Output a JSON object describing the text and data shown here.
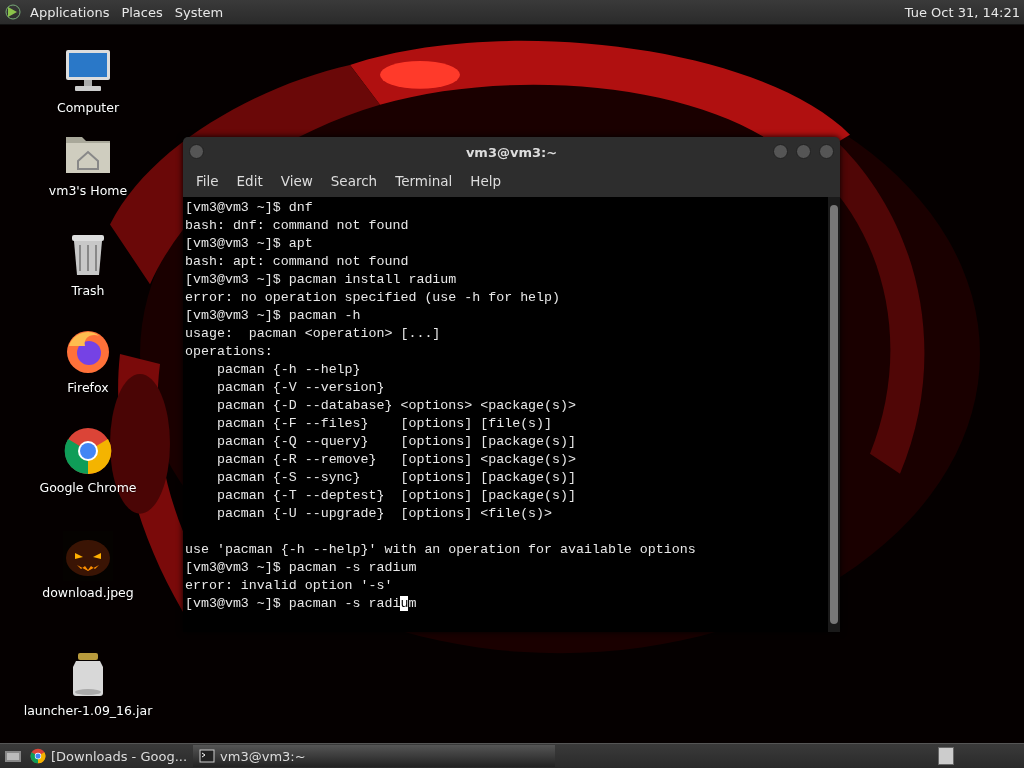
{
  "top_panel": {
    "menus": [
      "Applications",
      "Places",
      "System"
    ],
    "clock": "Tue Oct 31, 14:21"
  },
  "desktop_icons": [
    {
      "kind": "computer",
      "label": "Computer"
    },
    {
      "kind": "home",
      "label": "vm3's Home"
    },
    {
      "kind": "trash",
      "label": "Trash"
    },
    {
      "kind": "firefox",
      "label": "Firefox"
    },
    {
      "kind": "chrome",
      "label": "Google Chrome"
    },
    {
      "kind": "picture",
      "label": "download.jpeg"
    },
    {
      "kind": "jar",
      "label": "launcher-1.09_16.jar"
    }
  ],
  "terminal": {
    "title": "vm3@vm3:~",
    "menu": [
      "File",
      "Edit",
      "View",
      "Search",
      "Terminal",
      "Help"
    ],
    "blocks": [
      [
        "[vm3@vm3 ~]$ dnf",
        "bash: dnf: command not found",
        "[vm3@vm3 ~]$ apt",
        "bash: apt: command not found",
        "[vm3@vm3 ~]$ pacman install radium",
        "error: no operation specified (use -h for help)",
        "[vm3@vm3 ~]$ pacman -h",
        "usage:  pacman <operation> [...]",
        "operations:",
        "    pacman {-h --help}",
        "    pacman {-V --version}",
        "    pacman {-D --database} <options> <package(s)>",
        "    pacman {-F --files}    [options] [file(s)]",
        "    pacman {-Q --query}    [options] [package(s)]",
        "    pacman {-R --remove}   [options] <package(s)>",
        "    pacman {-S --sync}     [options] [package(s)]",
        "    pacman {-T --deptest}  [options] [package(s)]",
        "    pacman {-U --upgrade}  [options] <file(s)>"
      ],
      [
        "use 'pacman {-h --help}' with an operation for available options",
        "[vm3@vm3 ~]$ pacman -s radium",
        "error: invalid option '-s'"
      ]
    ],
    "input_line": {
      "before": "[vm3@vm3 ~]$ pacman -s radi",
      "cursor": "u",
      "after": "m"
    }
  },
  "taskbar": {
    "items": [
      {
        "kind": "chrome",
        "label": "[Downloads - Goog...",
        "selected": false
      },
      {
        "kind": "terminal",
        "label": "vm3@vm3:~",
        "selected": true
      }
    ]
  }
}
